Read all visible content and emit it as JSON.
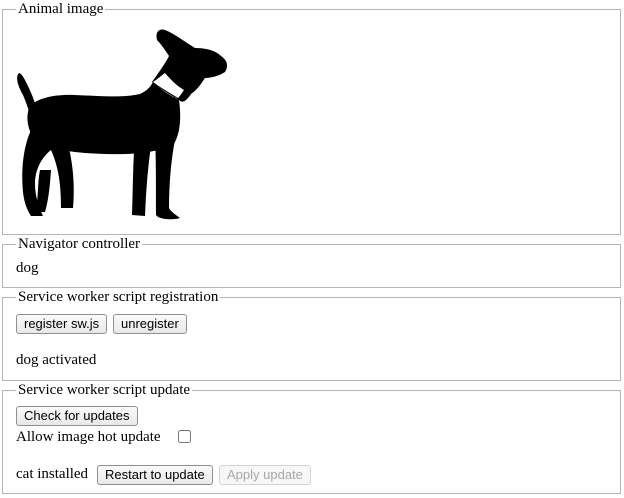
{
  "animal_section": {
    "legend": "Animal image",
    "image_icon": "dog-silhouette-icon"
  },
  "controller_section": {
    "legend": "Navigator controller",
    "value": "dog"
  },
  "registration_section": {
    "legend": "Service worker script registration",
    "register_label": "register sw.js",
    "unregister_label": "unregister",
    "status": "dog activated"
  },
  "update_section": {
    "legend": "Service worker script update",
    "check_label": "Check for updates",
    "hot_update_label": "Allow image hot update",
    "hot_update_checked": false,
    "status": "cat installed",
    "restart_label": "Restart to update",
    "apply_label": "Apply update",
    "apply_disabled": true
  }
}
